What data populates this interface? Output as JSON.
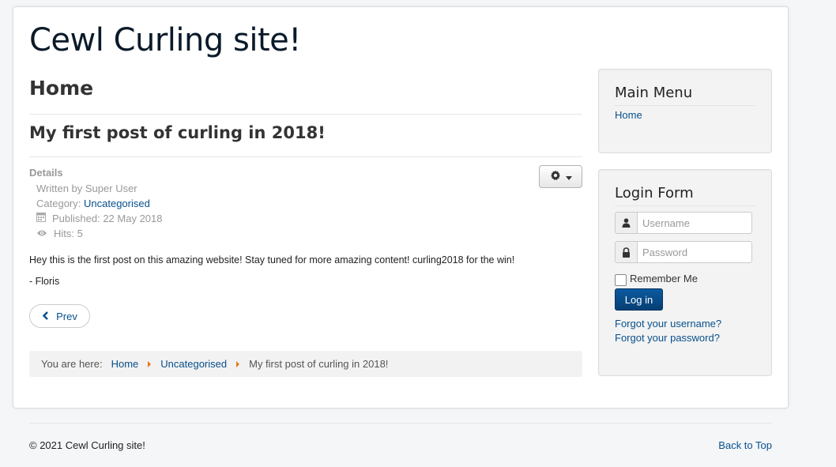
{
  "site": {
    "title": "Cewl Curling site!"
  },
  "page": {
    "heading": "Home"
  },
  "article": {
    "title": "My first post of curling in 2018!",
    "details_label": "Details",
    "written_by": "Written by Super User",
    "category_label": "Category: ",
    "category_value": "Uncategorised",
    "published": "Published: 22 May 2018",
    "hits": "Hits: 5",
    "body_paragraph_1": "Hey this is the first post on this amazing website! Stay tuned for more amazing content! curling2018 for the win!",
    "body_paragraph_2": "- Floris",
    "prev_label": "Prev"
  },
  "breadcrumb": {
    "prefix": "You are here:",
    "items": [
      "Home",
      "Uncategorised",
      "My first post of curling in 2018!"
    ]
  },
  "main_menu": {
    "title": "Main Menu",
    "items": [
      "Home"
    ]
  },
  "login_form": {
    "title": "Login Form",
    "username_placeholder": "Username",
    "password_placeholder": "Password",
    "remember_label": "Remember Me",
    "login_button": "Log in",
    "forgot_username": "Forgot your username?",
    "forgot_password": "Forgot your password?"
  },
  "footer": {
    "copyright": "© 2021 Cewl Curling site!",
    "back_to_top": "Back to Top"
  },
  "colors": {
    "link": "#08508c",
    "primary_button": "#063f73",
    "breadcrumb_separator": "#e07b1a"
  },
  "icons": [
    "gear-icon",
    "caret-down-icon",
    "calendar-icon",
    "eye-icon",
    "chevron-left-icon",
    "user-icon",
    "lock-icon"
  ]
}
